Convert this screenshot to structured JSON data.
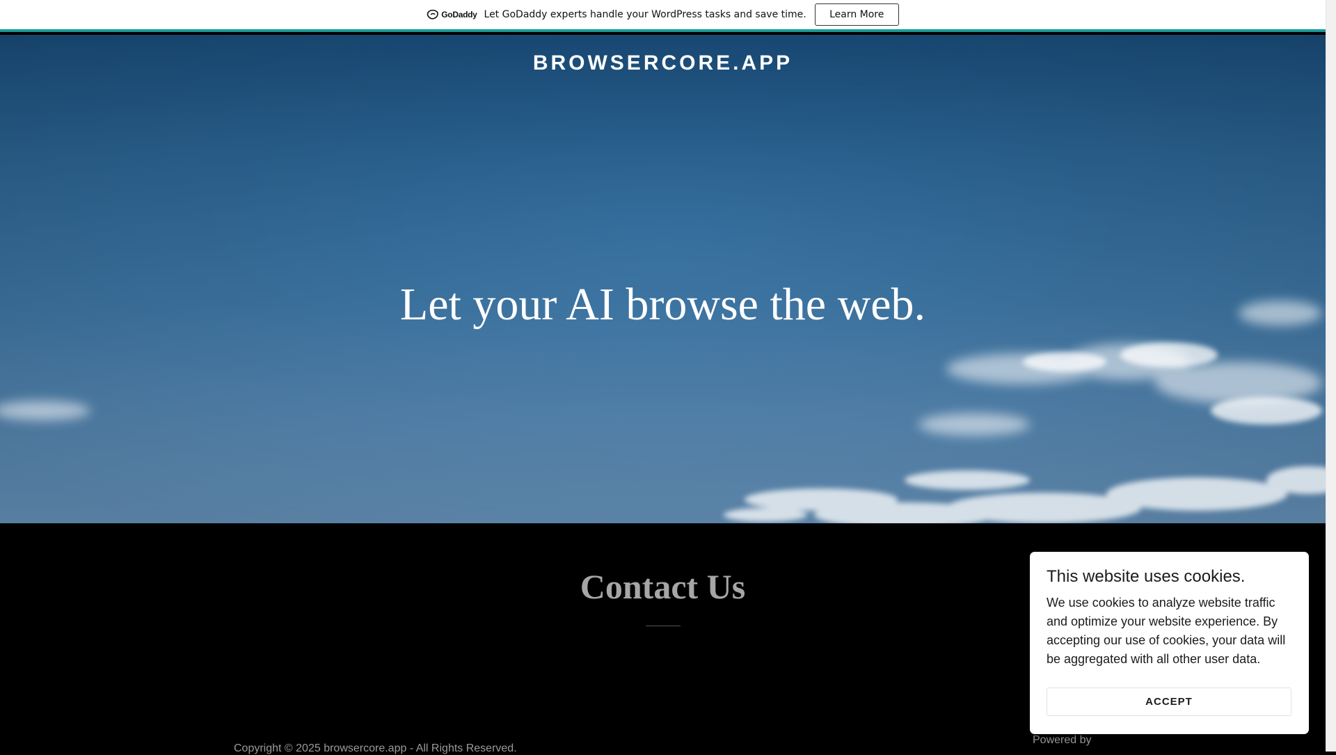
{
  "promo": {
    "logo_text": "GoDaddy",
    "message": "Let GoDaddy experts handle your WordPress tasks and save time.",
    "button_label": "Learn More",
    "accent_color": "#1b9a9a"
  },
  "hero": {
    "site_title": "BROWSERCORE.APP",
    "heading": "Let your AI browse the web."
  },
  "contact": {
    "heading": "Contact Us",
    "copyright": "Copyright © 2025 browsercore.app - All Rights Reserved.",
    "powered_by": "Powered by"
  },
  "cookie": {
    "title": "This website uses cookies.",
    "body": "We use cookies to analyze website traffic and optimize your website experience. By accepting our use of cookies, your data will be aggregated with all other user data.",
    "accept_label": "ACCEPT"
  }
}
